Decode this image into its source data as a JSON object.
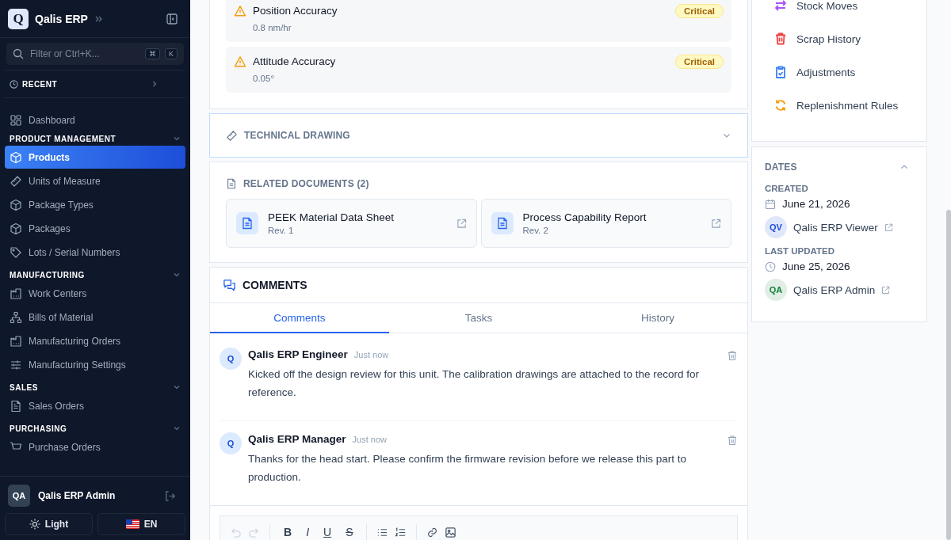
{
  "sidebar": {
    "brand": {
      "logo": "Q",
      "name": "Qalis ERP"
    },
    "search": {
      "placeholder": "Filter or Ctrl+K...",
      "keys": [
        "⌘",
        "K"
      ]
    },
    "recent": {
      "label": "RECENT",
      "expanded": false
    },
    "groups": [
      {
        "items": [
          {
            "label": "Dashboard",
            "selected": false
          }
        ]
      },
      {
        "title": "PRODUCT MANAGEMENT",
        "expanded": true,
        "items": [
          {
            "label": "Products",
            "selected": true
          },
          {
            "label": "Units of Measure",
            "selected": false
          },
          {
            "label": "Package Types",
            "selected": false
          },
          {
            "label": "Packages",
            "selected": false
          },
          {
            "label": "Lots / Serial Numbers",
            "selected": false
          }
        ]
      },
      {
        "title": "MANUFACTURING",
        "expanded": true,
        "items": [
          {
            "label": "Work Centers",
            "selected": false
          },
          {
            "label": "Bills of Material",
            "selected": false
          },
          {
            "label": "Manufacturing Orders",
            "selected": false
          },
          {
            "label": "Manufacturing Settings",
            "selected": false
          }
        ]
      },
      {
        "title": "SALES",
        "expanded": true,
        "items": [
          {
            "label": "Sales Orders",
            "selected": false
          }
        ]
      },
      {
        "title": "PURCHASING",
        "expanded": true,
        "items": [
          {
            "label": "Purchase Orders",
            "selected": false
          }
        ]
      }
    ],
    "user": {
      "initials": "QA",
      "name": "Qalis ERP Admin"
    },
    "theme": "Light",
    "language": "EN"
  },
  "issues": [
    {
      "title": "Position Accuracy",
      "value": "0.8 nm/hr",
      "severity": "Critical"
    },
    {
      "title": "Attitude Accuracy",
      "value": "0.05°",
      "severity": "Critical"
    }
  ],
  "technical_drawing": {
    "title": "TECHNICAL DRAWING",
    "expanded": false
  },
  "related_documents": {
    "title": "RELATED DOCUMENTS (2)",
    "items": [
      {
        "name": "PEEK Material Data Sheet",
        "revision": "Rev. 1"
      },
      {
        "name": "Process Capability Report",
        "revision": "Rev. 2"
      }
    ]
  },
  "comments": {
    "title": "COMMENTS",
    "tabs": [
      {
        "label": "Comments",
        "selected": true
      },
      {
        "label": "Tasks",
        "selected": false
      },
      {
        "label": "History",
        "selected": false
      }
    ],
    "items": [
      {
        "avatar": "Q",
        "author": "Qalis ERP Engineer",
        "time": "Just now",
        "text": "Kicked off the design review for this unit. The calibration drawings are attached to the record for reference."
      },
      {
        "avatar": "Q",
        "author": "Qalis ERP Manager",
        "time": "Just now",
        "text": "Thanks for the head start. Please confirm the firmware revision before we release this part to production."
      }
    ],
    "toolbar": {
      "history": [
        {
          "disabled": true
        },
        {
          "disabled": true
        }
      ],
      "marks": [
        "B",
        "I",
        "U",
        "S"
      ]
    }
  },
  "actions": [
    {
      "label": "Stock Moves",
      "color": "#a855f7"
    },
    {
      "label": "Scrap History",
      "color": "#ef4444"
    },
    {
      "label": "Adjustments",
      "color": "#3b82f6"
    },
    {
      "label": "Replenishment Rules",
      "color": "#f59e0b"
    }
  ],
  "dates": {
    "title": "DATES",
    "expanded": true,
    "entries": [
      {
        "label": "CREATED",
        "date": "June 21, 2026",
        "user": {
          "initials": "QV",
          "name": "Qalis ERP Viewer",
          "color": "#1d4ed8"
        }
      },
      {
        "label": "LAST UPDATED",
        "date": "June 25, 2026",
        "user": {
          "initials": "QA",
          "name": "Qalis ERP Admin",
          "color": "#15803d"
        }
      }
    ]
  }
}
